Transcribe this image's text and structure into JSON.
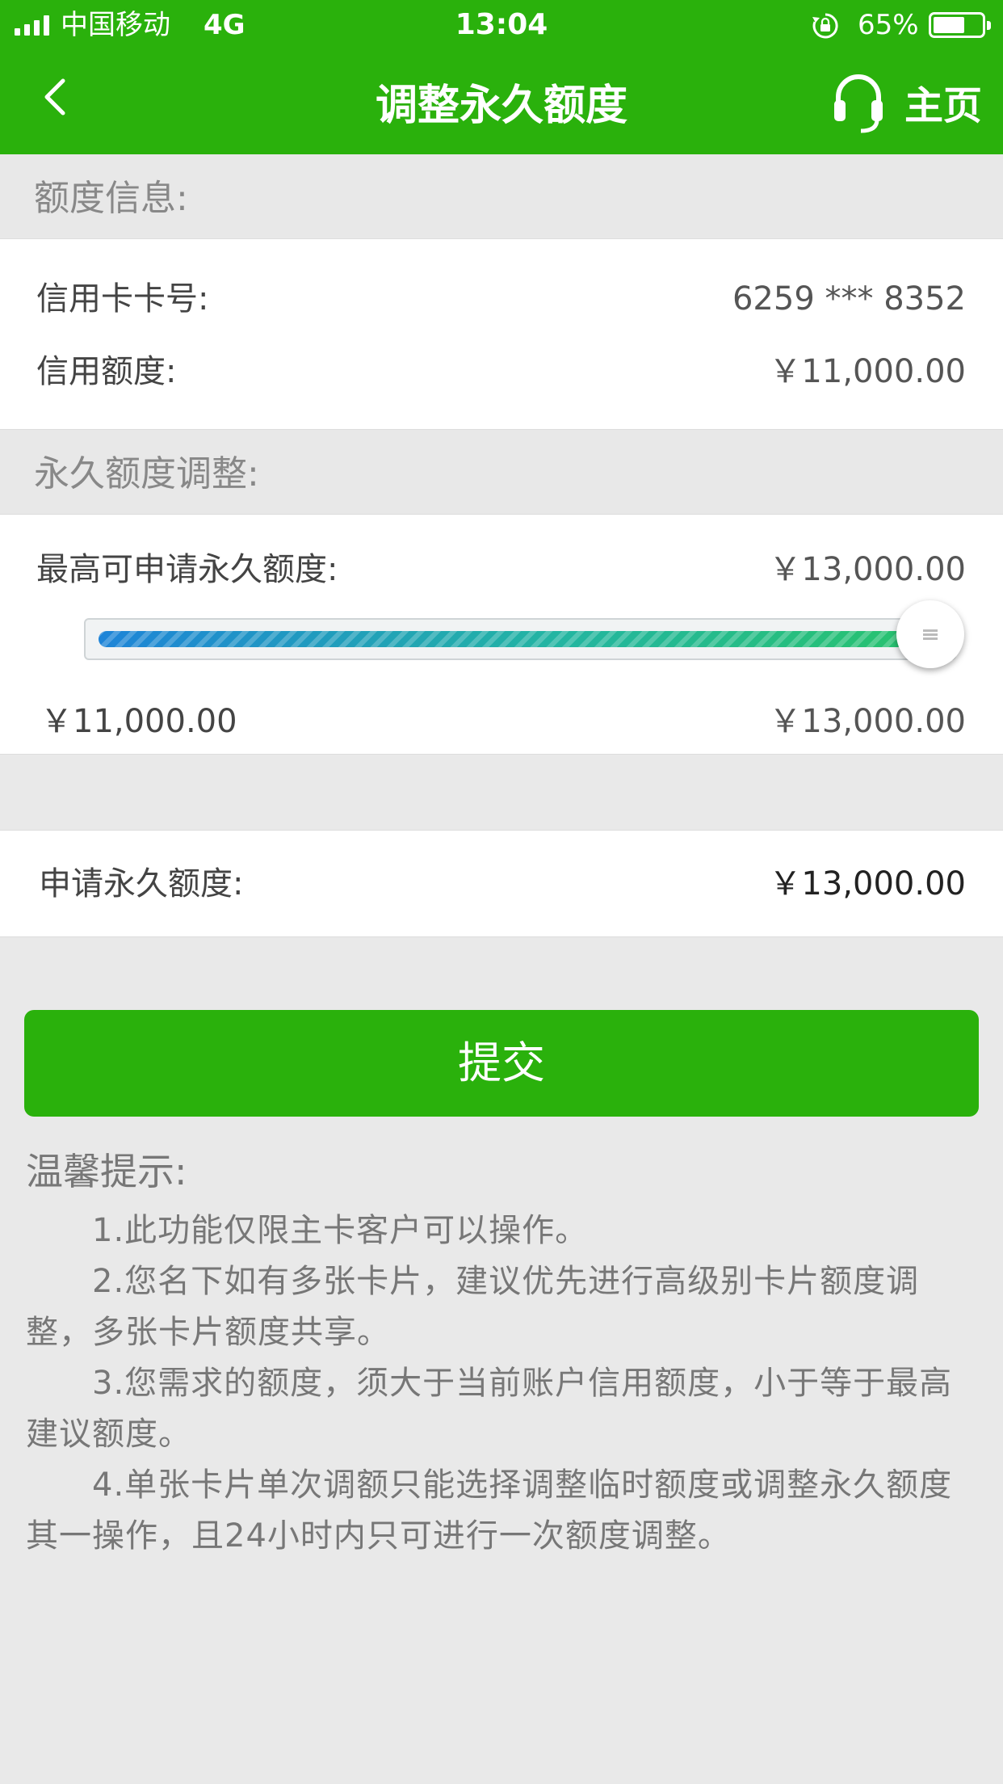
{
  "status_bar": {
    "carrier": "中国移动",
    "network": "4G",
    "time": "13:04",
    "battery": "65%",
    "battery_level": 0.65
  },
  "nav": {
    "title": "调整永久额度",
    "back_icon": "chevron-left-icon",
    "service_icon": "headset-icon",
    "home_label": "主页"
  },
  "credit_info": {
    "section_title": "额度信息:",
    "card_number_label": "信用卡卡号:",
    "card_number": "6259 *** 8352",
    "limit_label": "信用额度:",
    "limit_value": "￥11,000.00"
  },
  "adjust": {
    "section_title": "永久额度调整:",
    "max_label": "最高可申请永久额度:",
    "max_value": "￥13,000.00",
    "slider_min": "￥11,000.00",
    "slider_max": "￥13,000.00",
    "slider_min_value": 11000,
    "slider_max_value": 13000,
    "slider_current_value": 13000
  },
  "apply": {
    "label": "申请永久额度:",
    "value": "￥13,000.00"
  },
  "submit_label": "提交",
  "tips": {
    "title": "温馨提示:",
    "items": [
      "1.此功能仅限主卡客户可以操作。",
      "2.您名下如有多张卡片，建议优先进行高级别卡片额度调整，多张卡片额度共享。",
      "3.您需求的额度，须大于当前账户信用额度，小于等于最高建议额度。",
      "4.单张卡片单次调额只能选择调整临时额度或调整永久额度其一操作，且24小时内只可进行一次额度调整。"
    ]
  },
  "colors": {
    "brand_green": "#2ab10c",
    "page_bg": "#e9e9e9",
    "slider_start": "#1e84d8",
    "slider_end": "#28c36c"
  }
}
